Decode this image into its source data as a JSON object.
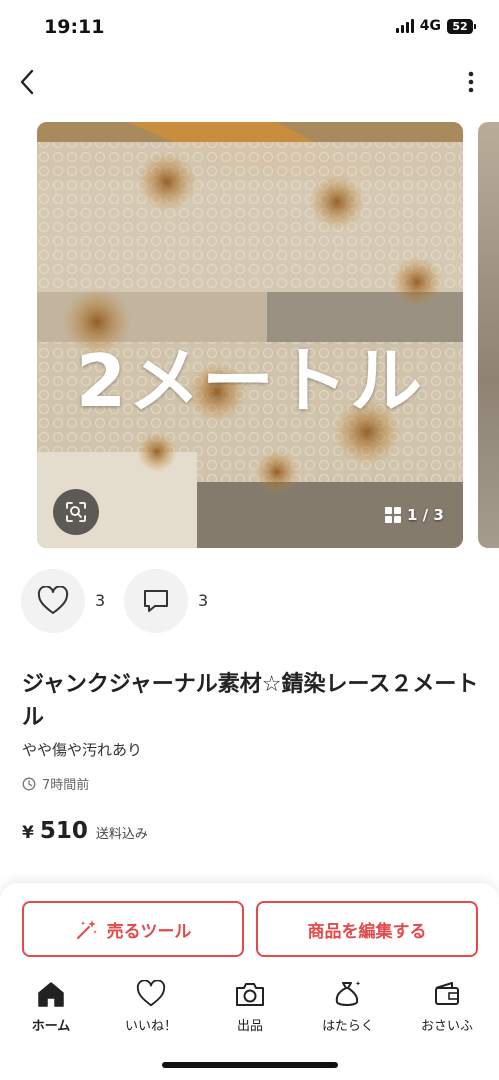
{
  "status_bar": {
    "time": "19:11",
    "network": "4G",
    "battery": "52"
  },
  "gallery": {
    "overlay_text": "2メートル",
    "counter": "1 / 3"
  },
  "engagement": {
    "likes": "3",
    "comments": "3"
  },
  "item": {
    "title": "ジャンクジャーナル素材☆錆染レース２メートル",
    "condition": "やや傷や汚れあり",
    "posted": "7時間前",
    "price_symbol": "¥",
    "price": "510",
    "shipping": "送料込み"
  },
  "actions": {
    "sell_tool": "売るツール",
    "edit_item": "商品を編集する"
  },
  "tabbar": {
    "items": [
      {
        "label": "ホーム",
        "icon": "home-icon"
      },
      {
        "label": "いいね！",
        "icon": "heart-icon"
      },
      {
        "label": "出品",
        "icon": "camera-icon"
      },
      {
        "label": "はたらく",
        "icon": "money-bag-icon"
      },
      {
        "label": "おさいふ",
        "icon": "wallet-icon"
      }
    ]
  },
  "colors": {
    "accent": "#e54a4a",
    "text": "#222222",
    "muted": "#666666"
  }
}
